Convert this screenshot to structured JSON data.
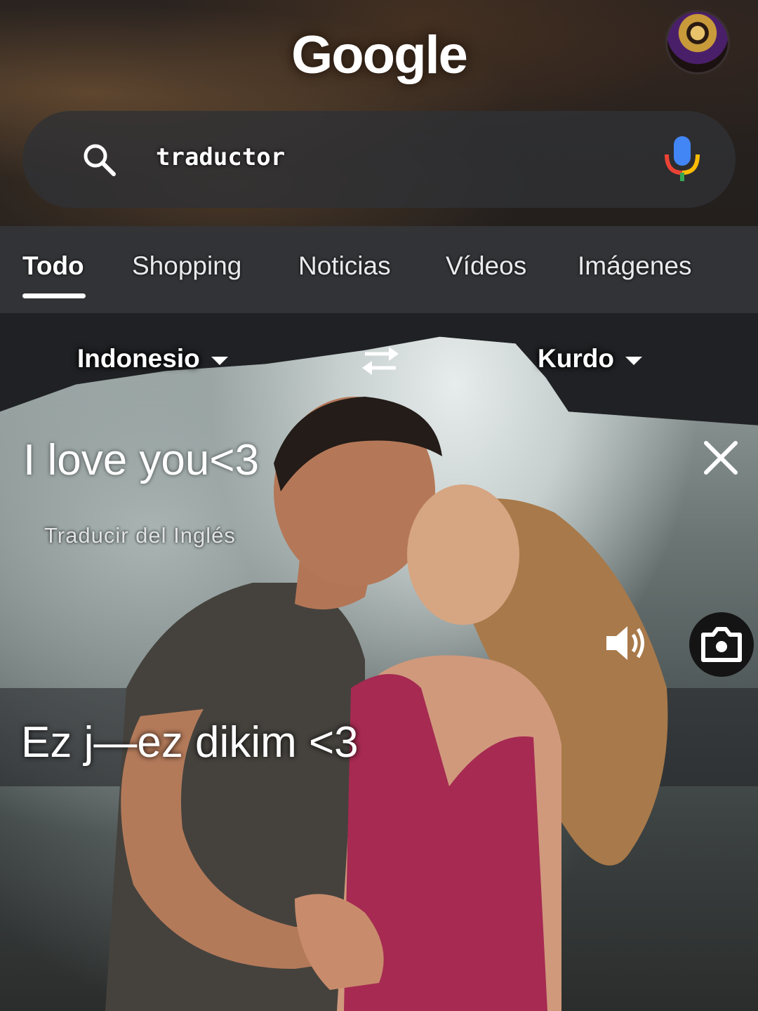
{
  "header": {
    "logo": "Google",
    "avatar_icon": "profile-avatar"
  },
  "search": {
    "query": "traductor",
    "icons": [
      "search-icon",
      "mic-icon"
    ]
  },
  "tabs": [
    {
      "label": "Todo",
      "active": true
    },
    {
      "label": "Shopping",
      "active": false
    },
    {
      "label": "Noticias",
      "active": false
    },
    {
      "label": "Vídeos",
      "active": false
    },
    {
      "label": "Imágenes",
      "active": false
    }
  ],
  "translator": {
    "source_lang": "Indonesio",
    "target_lang": "Kurdo",
    "source_text": "I love you<3",
    "detect_hint": "Traducir del Inglés",
    "result_text": "Ez j—ez dikim <3"
  },
  "colors": {
    "background": "#202124",
    "text": "#ffffff",
    "mic_blue": "#4285f4",
    "mic_red": "#ea4335",
    "mic_yellow": "#fbbc05",
    "mic_green": "#34a853"
  }
}
